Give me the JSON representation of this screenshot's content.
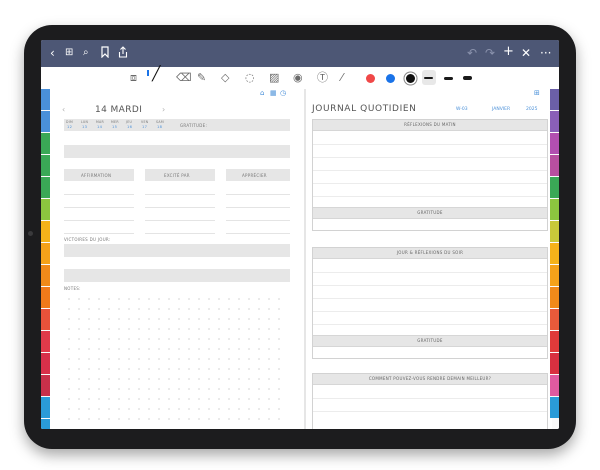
{
  "toolbar_top": {
    "back_icon": "chevron-left-icon",
    "grid_icon": "grid-icon",
    "search_icon": "search-icon",
    "bookmark_icon": "bookmark-icon",
    "share_icon": "share-icon",
    "undo_icon": "undo-icon",
    "redo_icon": "redo-icon",
    "add_icon": "plus-icon",
    "close_icon": "close-icon",
    "more_icon": "more-icon"
  },
  "tools": {
    "colors": [
      "#f04848",
      "#1a73e8",
      "#111111"
    ],
    "accent": "#4d5775"
  },
  "left_tabs": [
    {
      "label": "2025",
      "color": "#4a90d9"
    },
    {
      "label": "2026",
      "color": "#4a90d9"
    },
    {
      "label": "JAN",
      "color": "#3aa856"
    },
    {
      "label": "FEV",
      "color": "#3aa856"
    },
    {
      "label": "MAR",
      "color": "#3aa856"
    },
    {
      "label": "AVR",
      "color": "#8cc63f"
    },
    {
      "label": "MAI",
      "color": "#f5b21a"
    },
    {
      "label": "JUN",
      "color": "#f5a21a"
    },
    {
      "label": "JUL",
      "color": "#f08a1a"
    },
    {
      "label": "AOU",
      "color": "#f07a1a"
    },
    {
      "label": "SEP",
      "color": "#e8523a"
    },
    {
      "label": "OCT",
      "color": "#e03a4a"
    },
    {
      "label": "NOV",
      "color": "#d8304a"
    },
    {
      "label": "DEC",
      "color": "#c8304a"
    },
    {
      "label": "DEC",
      "color": "#2a9bd8"
    },
    {
      "label": "",
      "color": "#2a9bd8"
    }
  ],
  "right_tabs": [
    {
      "label": "2025",
      "color": "#6b5fa8"
    },
    {
      "label": "2026",
      "color": "#8a5fb8"
    },
    {
      "label": "JAN",
      "color": "#b24fb0"
    },
    {
      "label": "FEV",
      "color": "#b84fa0"
    },
    {
      "label": "MAR",
      "color": "#3aa856"
    },
    {
      "label": "AVR",
      "color": "#8cc63f"
    },
    {
      "label": "MAI",
      "color": "#c8c83a"
    },
    {
      "label": "JUN",
      "color": "#f5b21a"
    },
    {
      "label": "JUL",
      "color": "#f5a21a"
    },
    {
      "label": "AOU",
      "color": "#f08a1a"
    },
    {
      "label": "SEP",
      "color": "#e85a3a"
    },
    {
      "label": "OCT",
      "color": "#e03a3a"
    },
    {
      "label": "NOV",
      "color": "#d83040"
    },
    {
      "label": "DEC",
      "color": "#e05aa0"
    },
    {
      "label": "",
      "color": "#2a9bd8"
    }
  ],
  "left_page": {
    "date_title": "14 MARDI",
    "weekdays": [
      "DIM",
      "LUN",
      "MAR",
      "MER",
      "JEU",
      "VEN",
      "SAM"
    ],
    "day_numbers": [
      "12",
      "13",
      "14",
      "15",
      "16",
      "17",
      "18"
    ],
    "gratitude_label": "GRATITUDE:",
    "col1": "AFFIRMATION",
    "col2": "EXCITÉ PAR",
    "col3": "APPRÉCIER",
    "victories_label": "VICTOIRES DU JOUR:",
    "notes_label": "NOTES:"
  },
  "right_page": {
    "title": "JOURNAL QUOTIDIEN",
    "week": "W-03",
    "month": "JANVIER",
    "year": "2025",
    "morning_header": "RÉFLEXIONS DU MATIN",
    "gratitude1": "GRATITUDE",
    "evening_header": "JOUR & RÉFLEXIONS DU SOIR",
    "gratitude2": "GRATITUDE",
    "tomorrow_header": "COMMENT POUVEZ-VOUS RENDRE DEMAIN MEILLEUR?"
  }
}
